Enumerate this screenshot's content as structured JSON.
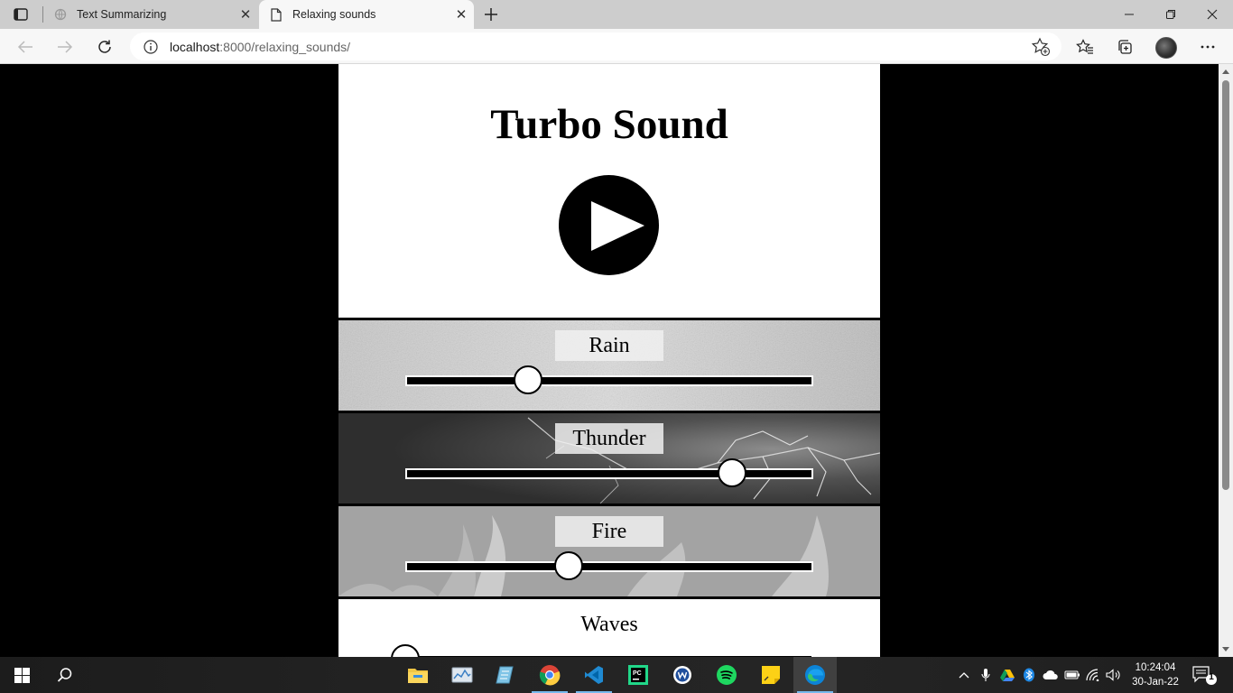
{
  "browser": {
    "tabs": [
      {
        "title": "Text Summarizing",
        "active": false
      },
      {
        "title": "Relaxing sounds",
        "active": true
      }
    ],
    "address": {
      "host": "localhost",
      "path": ":8000/relaxing_sounds/"
    }
  },
  "page": {
    "title": "Turbo Sound",
    "sounds": [
      {
        "label": "Rain",
        "level": 0.3
      },
      {
        "label": "Thunder",
        "level": 0.8
      },
      {
        "label": "Fire",
        "level": 0.4
      },
      {
        "label": "Waves",
        "level": 0.0
      }
    ]
  },
  "taskbar": {
    "apps": [
      "file-explorer",
      "task-manager",
      "notepad",
      "chrome",
      "vscode",
      "pycharm",
      "app-w",
      "spotify",
      "sticky-notes",
      "edge"
    ],
    "clock": {
      "time": "10:24:04",
      "date": "30-Jan-22"
    },
    "notifications": "1"
  }
}
